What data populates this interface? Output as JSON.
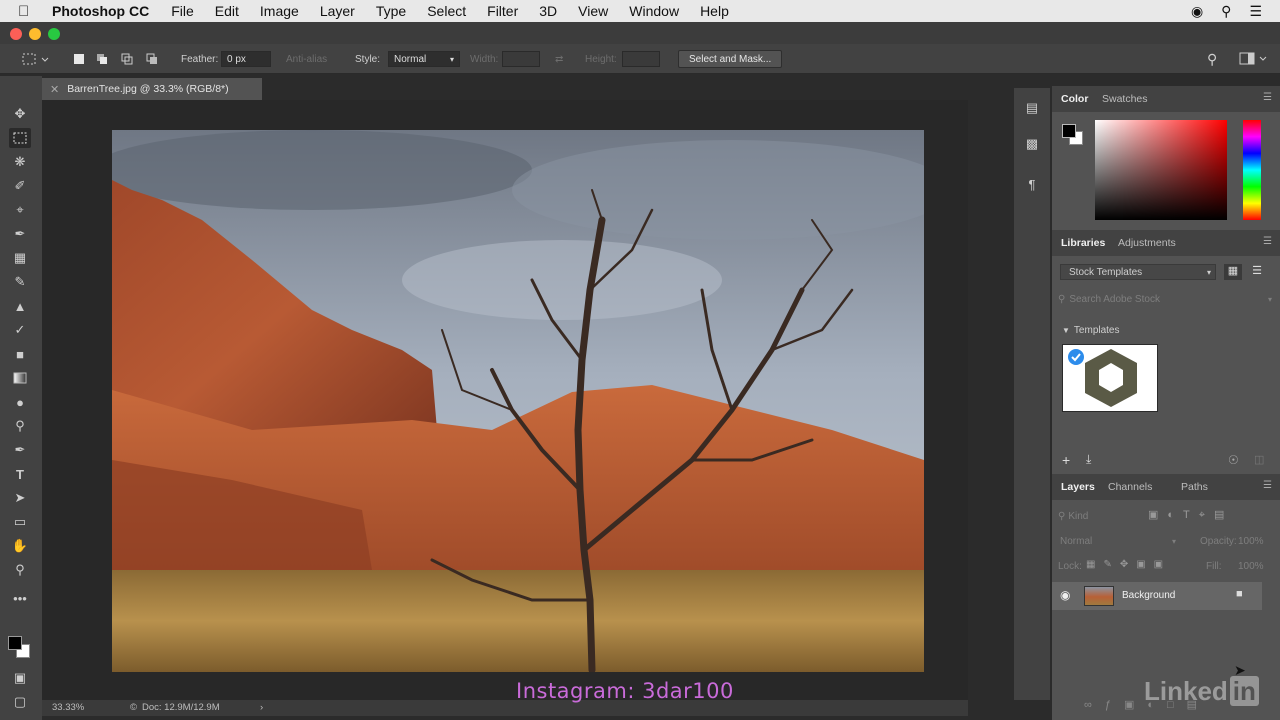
{
  "menubar": {
    "app_name": "Photoshop CC",
    "items": [
      "File",
      "Edit",
      "Image",
      "Layer",
      "Type",
      "Select",
      "Filter",
      "3D",
      "View",
      "Window",
      "Help"
    ]
  },
  "options": {
    "feather_label": "Feather:",
    "feather_value": "0 px",
    "antialias_label": "Anti-alias",
    "style_label": "Style:",
    "style_value": "Normal",
    "width_label": "Width:",
    "height_label": "Height:",
    "select_mask_label": "Select and Mask..."
  },
  "document": {
    "tab_title": "BarrenTree.jpg @ 33.3% (RGB/8*)",
    "zoom": "33.33%",
    "doc_info": "Doc: 12.9M/12.9M"
  },
  "color_panel": {
    "tabs": [
      "Color",
      "Swatches"
    ],
    "foreground": "#000000",
    "background": "#ffffff",
    "hue": "#ff0000"
  },
  "libraries_panel": {
    "tabs": [
      "Libraries",
      "Adjustments"
    ],
    "library_name": "Stock Templates",
    "search_placeholder": "Search Adobe Stock",
    "section_title": "Templates"
  },
  "layers_panel": {
    "tabs": [
      "Layers",
      "Channels",
      "Paths"
    ],
    "filter_kind": "Kind",
    "blend_mode": "Normal",
    "opacity_label": "Opacity:",
    "opacity_value": "100%",
    "lock_label": "Lock:",
    "fill_label": "Fill:",
    "fill_value": "100%",
    "layers": [
      {
        "name": "Background",
        "visible": true,
        "locked": true
      }
    ]
  },
  "overlays": {
    "watermark": "Instagram:  3dar100",
    "brand": "Linked"
  }
}
